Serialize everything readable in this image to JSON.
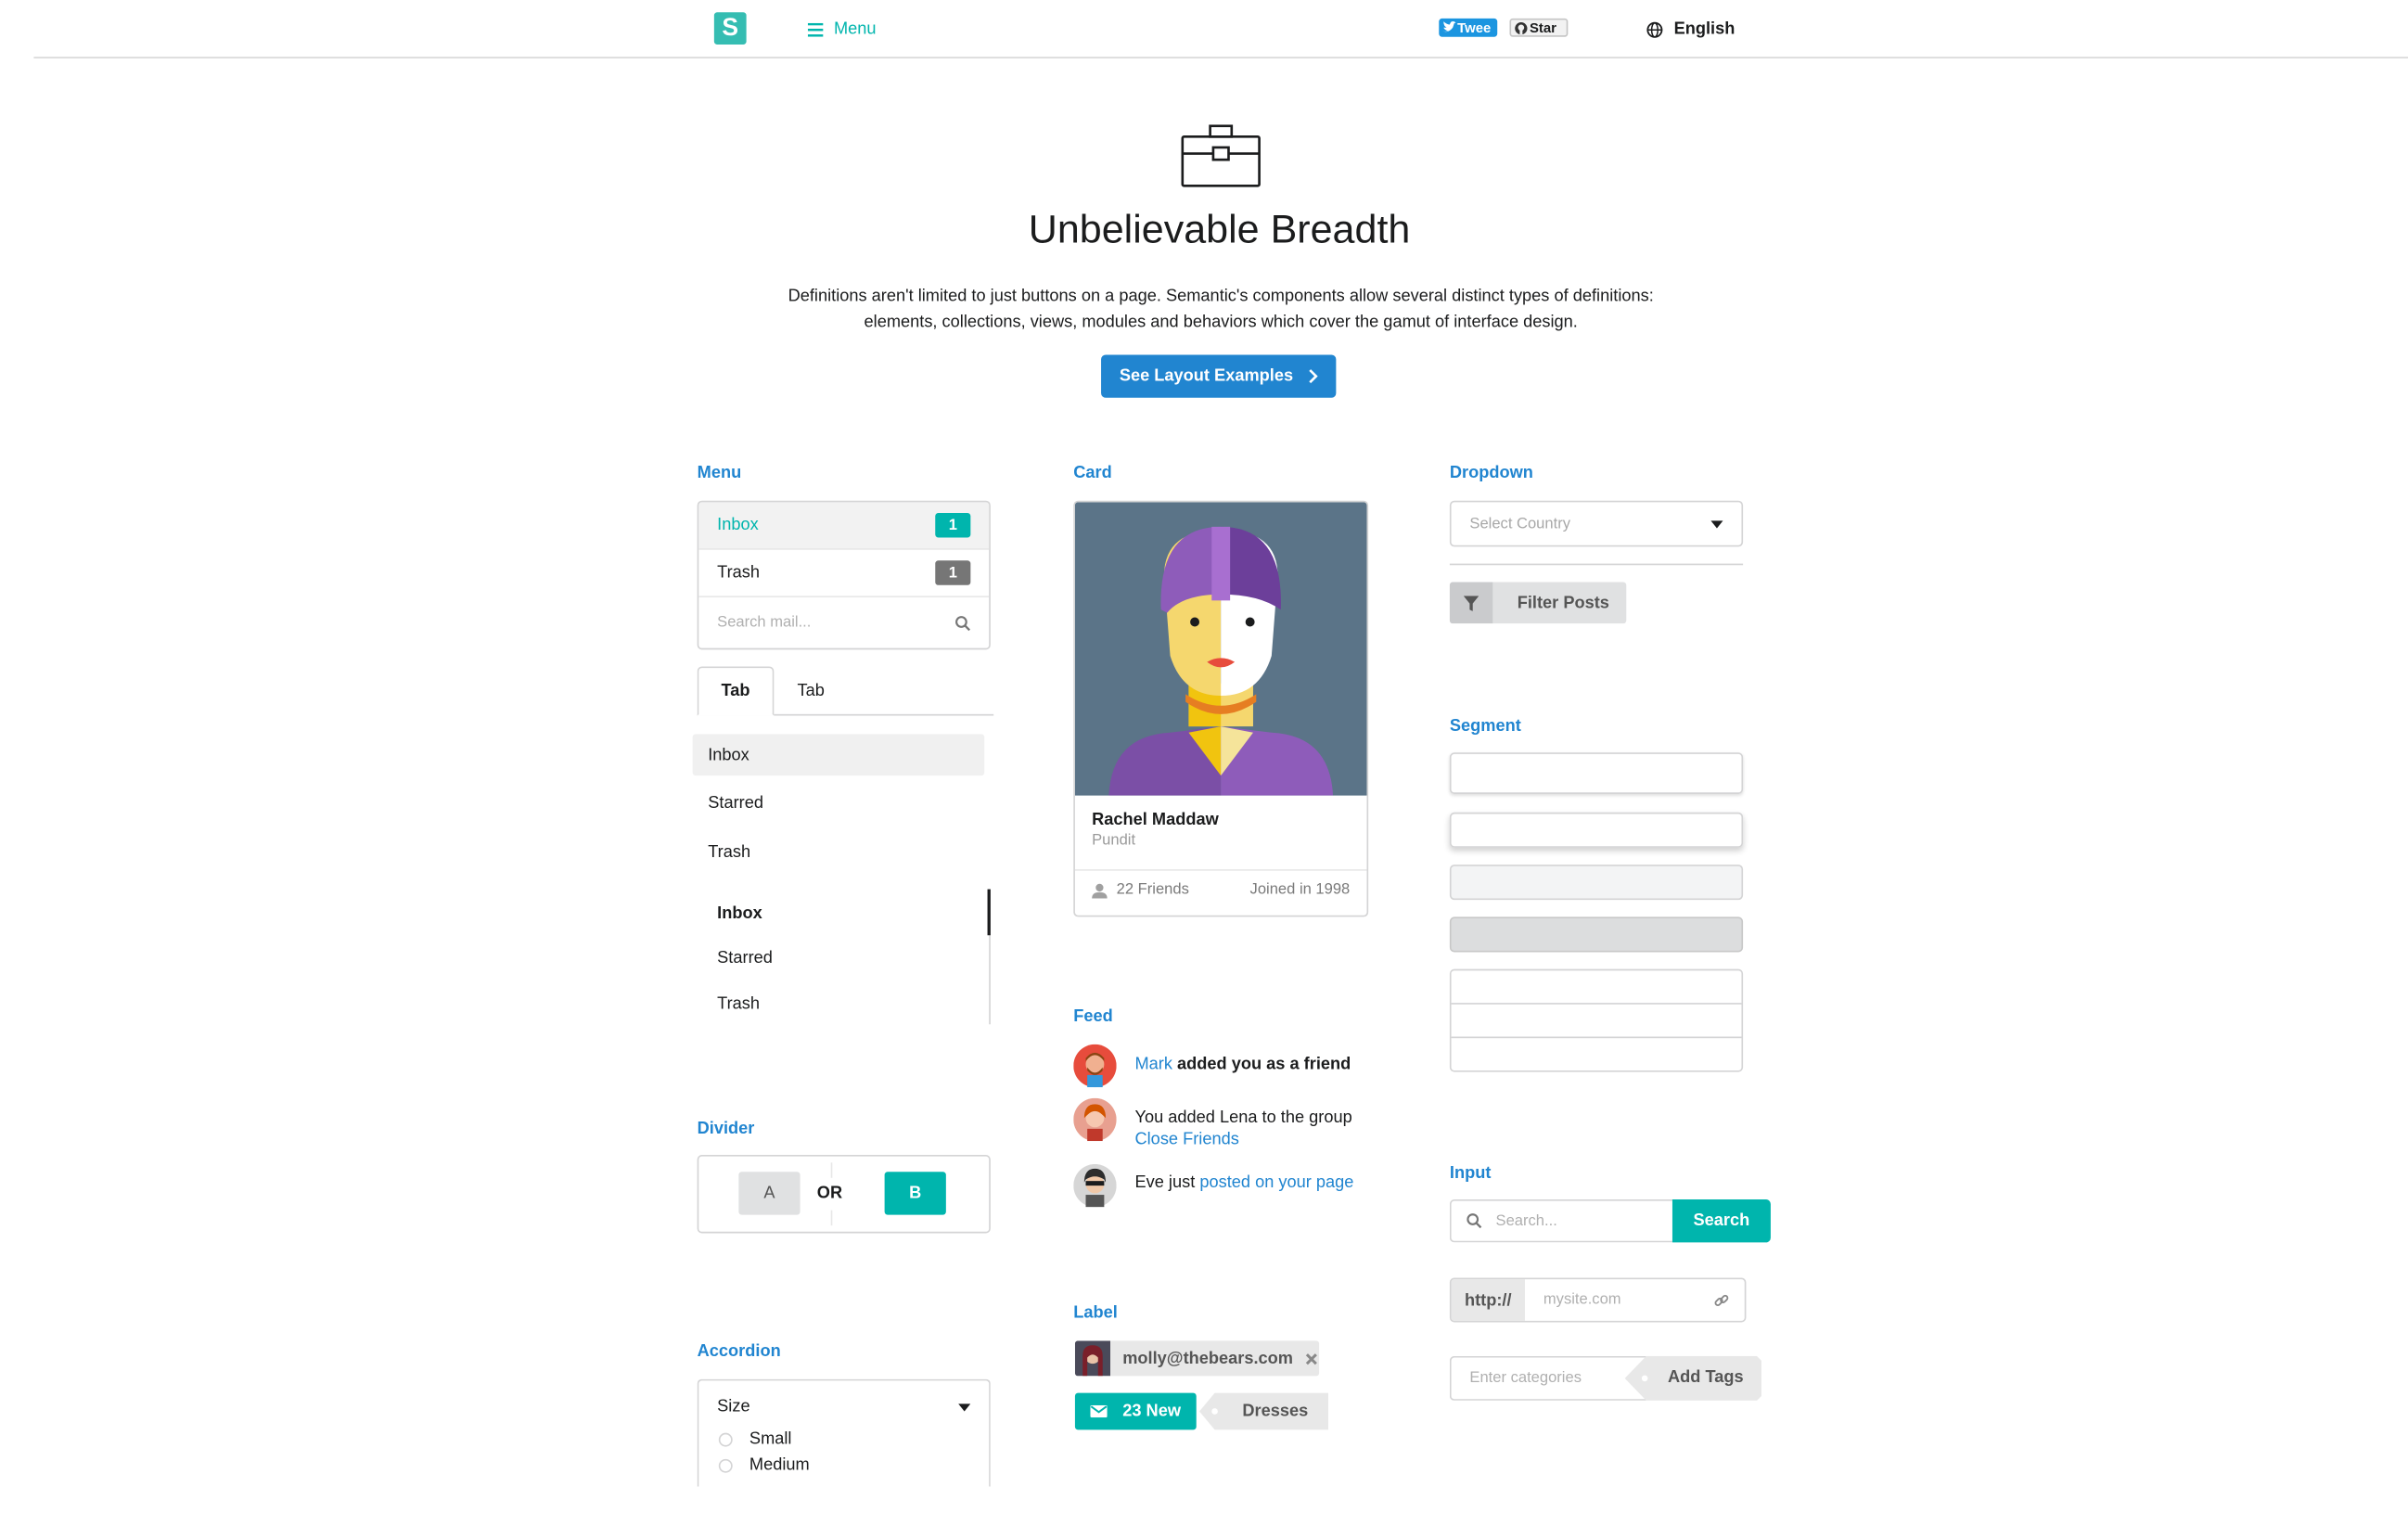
{
  "topbar": {
    "logo_letter": "S",
    "menu_label": "Menu",
    "tweet_label": "Twee",
    "star_label": "Star",
    "language": "English"
  },
  "hero": {
    "title": "Unbelievable Breadth",
    "description_line1": "Definitions aren't limited to just buttons on a page. Semantic's components allow several distinct types of definitions:",
    "description_line2": "elements, collections, views, modules and behaviors which cover the gamut of interface design.",
    "button_label": "See Layout Examples"
  },
  "menu_section": {
    "title": "Menu",
    "items": [
      {
        "label": "Inbox",
        "count": "1"
      },
      {
        "label": "Trash",
        "count": "1"
      }
    ],
    "search_placeholder": "Search mail..."
  },
  "tabs": {
    "labels": [
      "Tab",
      "Tab"
    ]
  },
  "vertical_menu": {
    "items": [
      "Inbox",
      "Starred",
      "Trash"
    ]
  },
  "secondary_menu": {
    "items": [
      "Inbox",
      "Starred",
      "Trash"
    ]
  },
  "divider_section": {
    "title": "Divider",
    "a_label": "A",
    "or_label": "OR",
    "b_label": "B"
  },
  "accordion_section": {
    "title": "Accordion",
    "header": "Size",
    "options": [
      "Small",
      "Medium"
    ]
  },
  "card_section": {
    "title": "Card",
    "name": "Rachel Maddaw",
    "meta": "Pundit",
    "friends": "22 Friends",
    "joined": "Joined in 1998"
  },
  "feed_section": {
    "title": "Feed",
    "events": [
      {
        "user": "Mark",
        "text": "added you as a friend"
      },
      {
        "text": "You added Lena to the group",
        "link": "Close Friends"
      },
      {
        "text": "Eve just",
        "link": "posted on your page"
      }
    ]
  },
  "label_section": {
    "title": "Label",
    "email": "molly@thebears.com",
    "new_count": "23 New",
    "tag": "Dresses"
  },
  "dropdown_section": {
    "title": "Dropdown",
    "placeholder": "Select Country",
    "filter_label": "Filter Posts"
  },
  "segment_section": {
    "title": "Segment"
  },
  "input_section": {
    "title": "Input",
    "search_placeholder": "Search...",
    "search_button": "Search",
    "url_prefix": "http://",
    "url_placeholder": "mysite.com",
    "tags_placeholder": "Enter categories",
    "tags_button": "Add Tags"
  },
  "colors": {
    "teal": "#00b5ad",
    "blue": "#2185d0",
    "grey_badge": "#767676",
    "card_bg": "#5b7488"
  }
}
